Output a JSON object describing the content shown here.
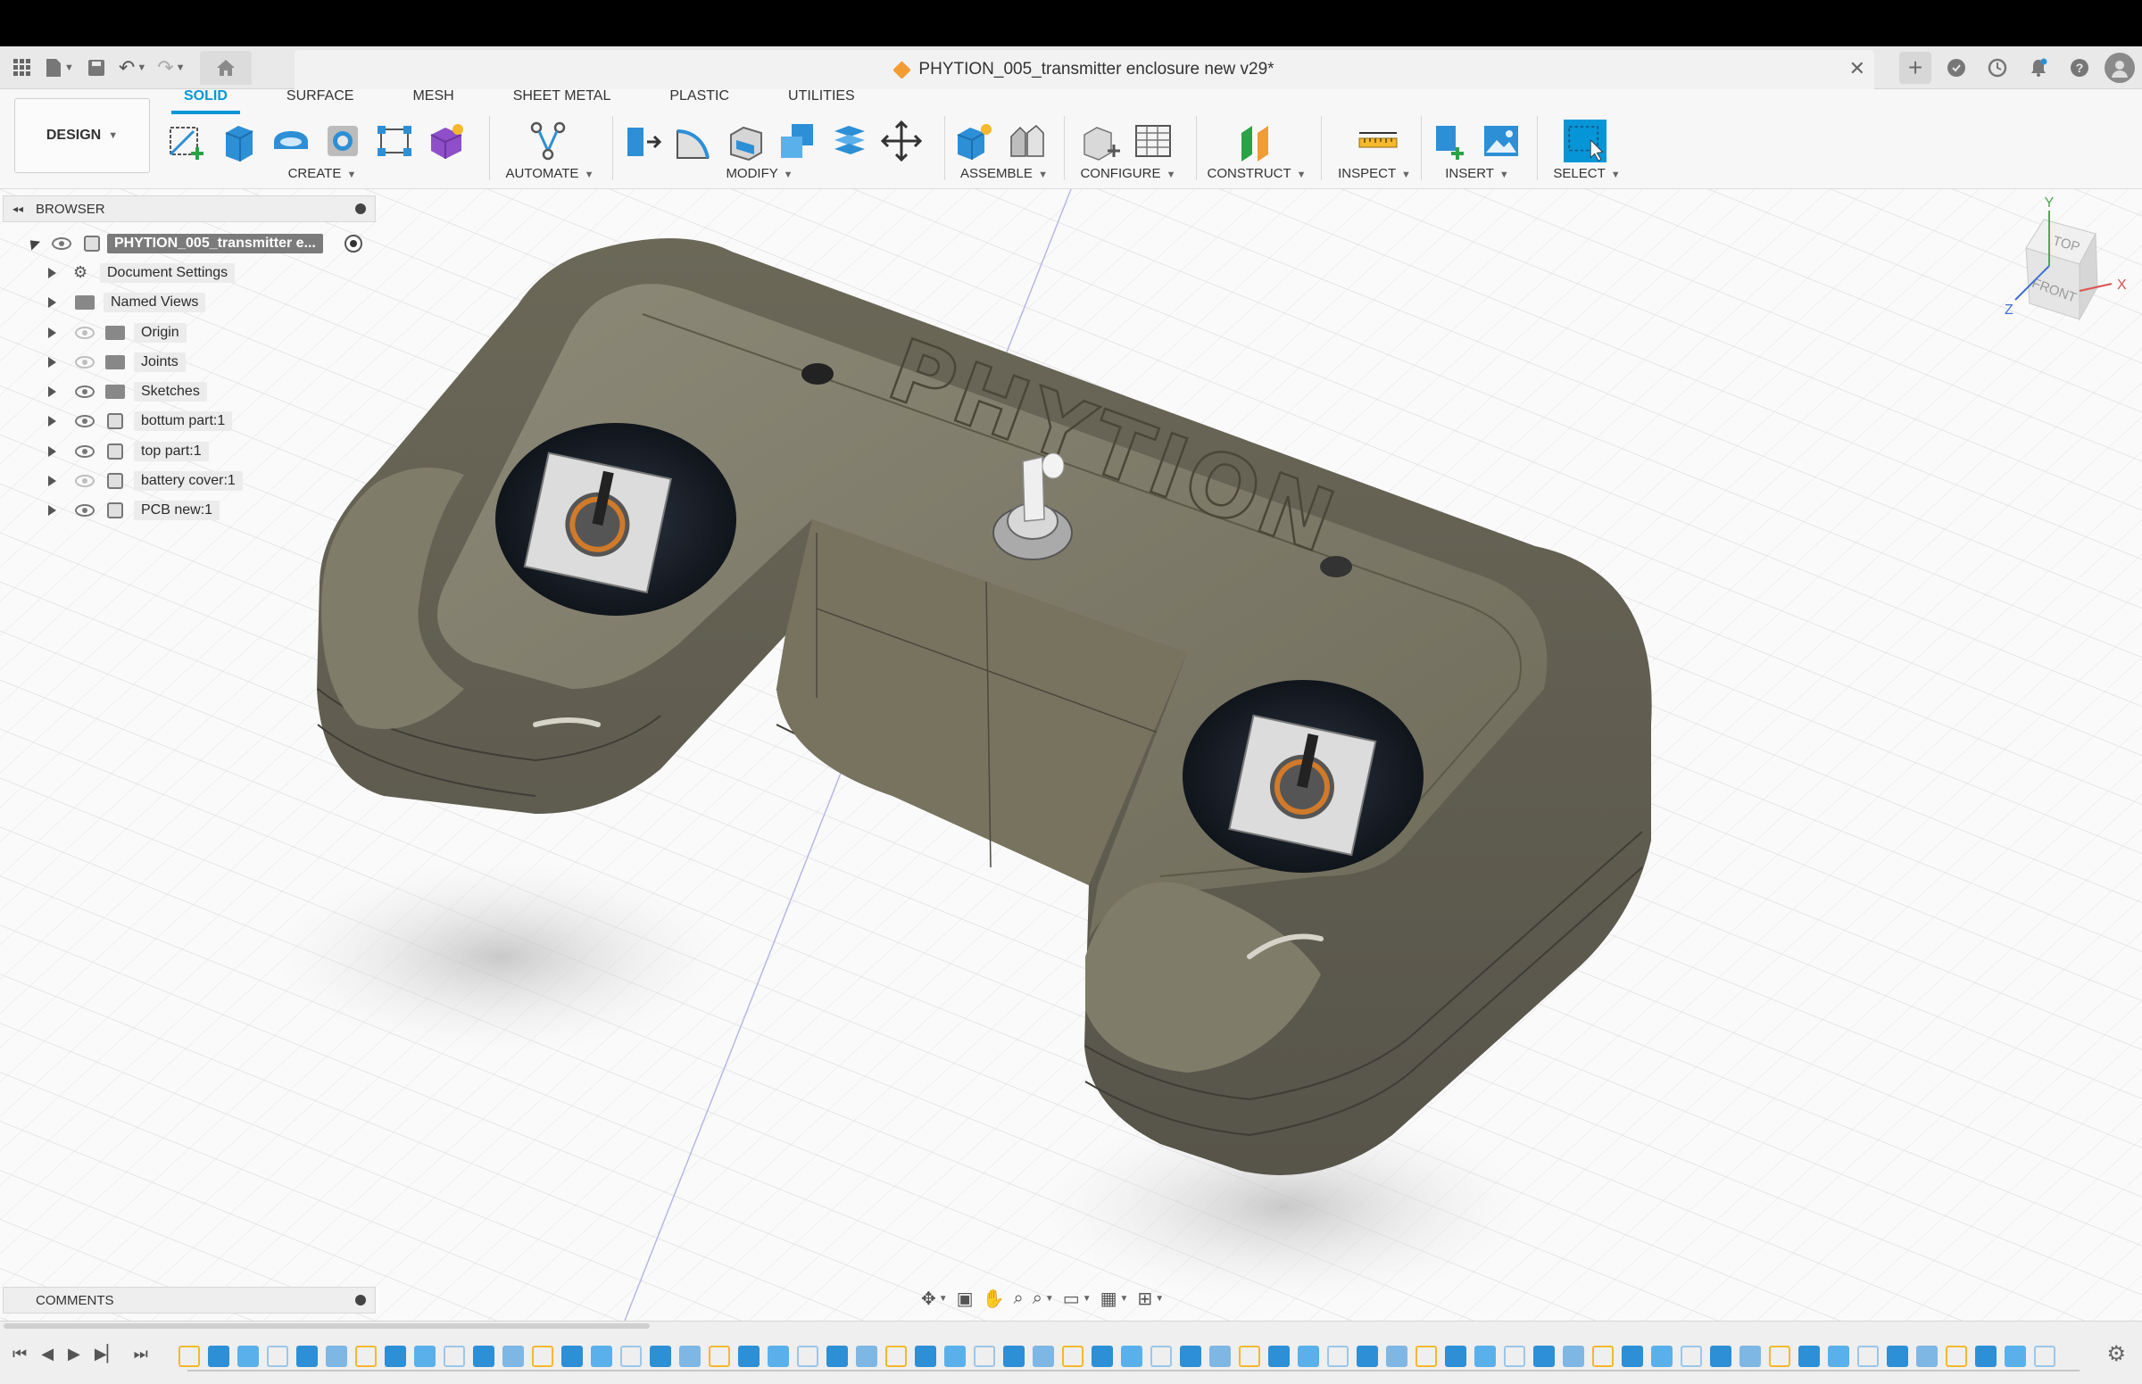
{
  "title_bar": {
    "document_title": "PHYTION_005_transmitter enclosure new v29*",
    "close_glyph": "✕",
    "icons": [
      "apps-grid-icon",
      "file-icon",
      "save-icon",
      "undo-icon",
      "redo-icon",
      "home-icon"
    ],
    "right_icons": [
      "new-tab-plus-icon",
      "extensions-icon",
      "job-status-icon",
      "notifications-icon",
      "help-icon",
      "profile-avatar-icon"
    ]
  },
  "ribbon": {
    "workspace_label": "DESIGN",
    "tabs": [
      "SOLID",
      "SURFACE",
      "MESH",
      "SHEET METAL",
      "PLASTIC",
      "UTILITIES"
    ],
    "active_tab": "SOLID",
    "groups": {
      "create": "CREATE",
      "automate": "AUTOMATE",
      "modify": "MODIFY",
      "assemble": "ASSEMBLE",
      "configure": "CONFIGURE",
      "construct": "CONSTRUCT",
      "inspect": "INSPECT",
      "insert": "INSERT",
      "select": "SELECT"
    }
  },
  "browser": {
    "header": "BROWSER",
    "root": "PHYTION_005_transmitter e...",
    "items": [
      {
        "label": "Document Settings",
        "icon": "gear-icon"
      },
      {
        "label": "Named Views",
        "icon": "folder-icon"
      },
      {
        "label": "Origin",
        "icon": "folder-icon",
        "hidden": true
      },
      {
        "label": "Joints",
        "icon": "folder-icon",
        "hidden": true
      },
      {
        "label": "Sketches",
        "icon": "folder-icon"
      },
      {
        "label": "bottum part:1",
        "icon": "component-icon"
      },
      {
        "label": "top part:1",
        "icon": "component-icon"
      },
      {
        "label": "battery cover:1",
        "icon": "component-icon",
        "hidden": true
      },
      {
        "label": "PCB new:1",
        "icon": "component-icon"
      }
    ]
  },
  "comments": {
    "header": "COMMENTS"
  },
  "viewcube": {
    "top": "TOP",
    "front": "FRONT",
    "axis_x": "X",
    "axis_y": "Y",
    "axis_z": "Z"
  },
  "model": {
    "engraving": "PHYTION"
  },
  "colors": {
    "accent": "#0696d7",
    "model_body": "#75715f",
    "timeline_blue": "#2d8fd6"
  }
}
